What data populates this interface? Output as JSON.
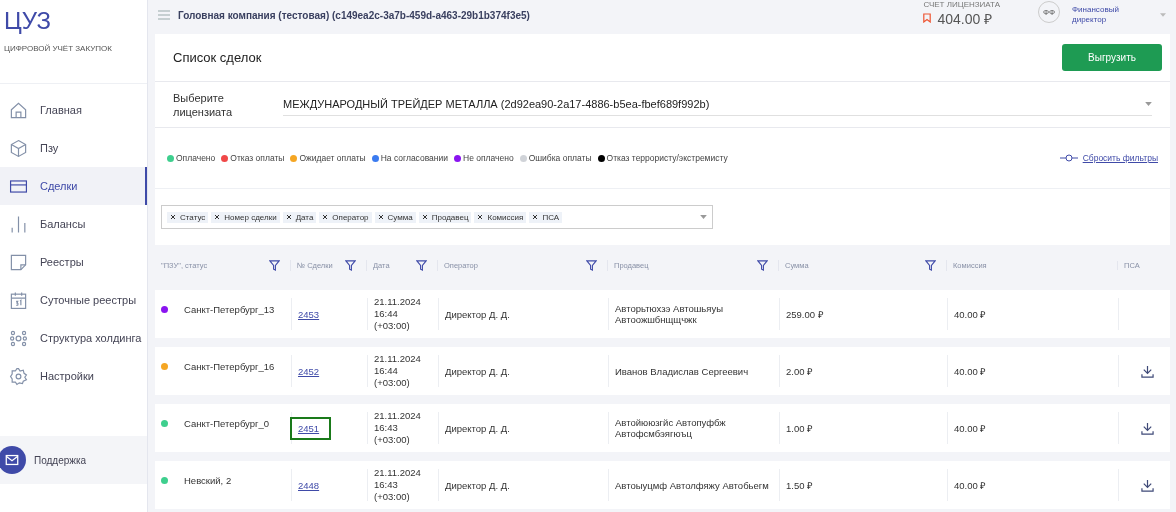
{
  "logo": {
    "title": "ЦУЗ",
    "subtitle": "ЦИФРОВОЙ УЧЁТ ЗАКУПОК"
  },
  "sidebar": {
    "items": [
      {
        "label": "Главная",
        "selected": false
      },
      {
        "label": "Пзу",
        "selected": false
      },
      {
        "label": "Сделки",
        "selected": true
      },
      {
        "label": "Балансы",
        "selected": false
      },
      {
        "label": "Реестры",
        "selected": false
      },
      {
        "label": "Суточные реестры",
        "selected": false
      },
      {
        "label": "Структура холдинга",
        "selected": false
      },
      {
        "label": "Настройки",
        "selected": false
      }
    ],
    "support": "Поддержка"
  },
  "header": {
    "company": "Головная компания (тестовая) (c149ea2c-3a7b-459d-a463-29b1b374f3e5)",
    "balance_label": "СЧЕТ ЛИЦЕНЗИАТА",
    "balance": "404.00 ₽",
    "avatar": "ФФ",
    "role": "Финансовый директор"
  },
  "page": {
    "title": "Список сделок",
    "export_button": "Выгрузить"
  },
  "licensee": {
    "label": "Выберите лицензиата",
    "value": "МЕЖДУНАРОДНЫЙ ТРЕЙДЕР МЕТАЛЛА (2d92ea90-2a17-4886-b5ea-fbef689f992b)"
  },
  "legend": [
    {
      "label": "Оплачено",
      "color": "#3ecf8e"
    },
    {
      "label": "Отказ оплаты",
      "color": "#f04848"
    },
    {
      "label": "Ожидает оплаты",
      "color": "#f5a623"
    },
    {
      "label": "На согласовании",
      "color": "#3b7bf0"
    },
    {
      "label": "Не оплачено",
      "color": "#8a14f0"
    },
    {
      "label": "Ошибка оплаты",
      "color": "#d0d3d8"
    },
    {
      "label": "Отказ террористу/экстремисту",
      "color": "#000000"
    }
  ],
  "reset_filters": "Сбросить фильтры",
  "column_tags": [
    "Статус",
    "Номер сделки",
    "Дата",
    "Оператор",
    "Сумма",
    "Продавец",
    "Комиссия",
    "ПСА"
  ],
  "table": {
    "columns": [
      {
        "label": "\"ПЗУ\", статус",
        "filter": true
      },
      {
        "label": "№ Сделки",
        "filter": true
      },
      {
        "label": "Дата",
        "filter": true
      },
      {
        "label": "Оператор",
        "filter": true
      },
      {
        "label": "Продавец",
        "filter": true
      },
      {
        "label": "Сумма",
        "filter": true
      },
      {
        "label": "Комиссия",
        "filter": false
      },
      {
        "label": "ПСА",
        "filter": false
      }
    ],
    "rows": [
      {
        "color": "#8a14f0",
        "pzu": "Санкт-Петербург_13",
        "number": "2453",
        "focused": false,
        "date": "21.11.2024",
        "time": "16:44",
        "tz": "(+03:00)",
        "operator": "Директор Д. Д.",
        "seller": "Авторьтюхзэ Автошьяуы Автоожшбнщщчжк",
        "sum": "259.00 ₽",
        "commission": "40.00 ₽",
        "download": false
      },
      {
        "color": "#f5a623",
        "pzu": "Санкт-Петербург_16",
        "number": "2452",
        "focused": false,
        "date": "21.11.2024",
        "time": "16:44",
        "tz": "(+03:00)",
        "operator": "Директор Д. Д.",
        "seller": "Иванов Владислав Сергеевич",
        "sum": "2.00 ₽",
        "commission": "40.00 ₽",
        "download": true
      },
      {
        "color": "#3ecf8e",
        "pzu": "Санкт-Петербург_0",
        "number": "2451",
        "focused": true,
        "date": "21.11.2024",
        "time": "16:43",
        "tz": "(+03:00)",
        "operator": "Директор Д. Д.",
        "seller": "Автойююзгйс Автопуфбж Автофсмбэягюъц",
        "sum": "1.00 ₽",
        "commission": "40.00 ₽",
        "download": true
      },
      {
        "color": "#3ecf8e",
        "pzu": "Невский, 2",
        "number": "2448",
        "focused": false,
        "date": "21.11.2024",
        "time": "16:43",
        "tz": "(+03:00)",
        "operator": "Директор Д. Д.",
        "seller": "Автоыуцмф Автолфяжу Автобьегм",
        "sum": "1.50 ₽",
        "commission": "40.00 ₽",
        "download": true
      }
    ]
  }
}
